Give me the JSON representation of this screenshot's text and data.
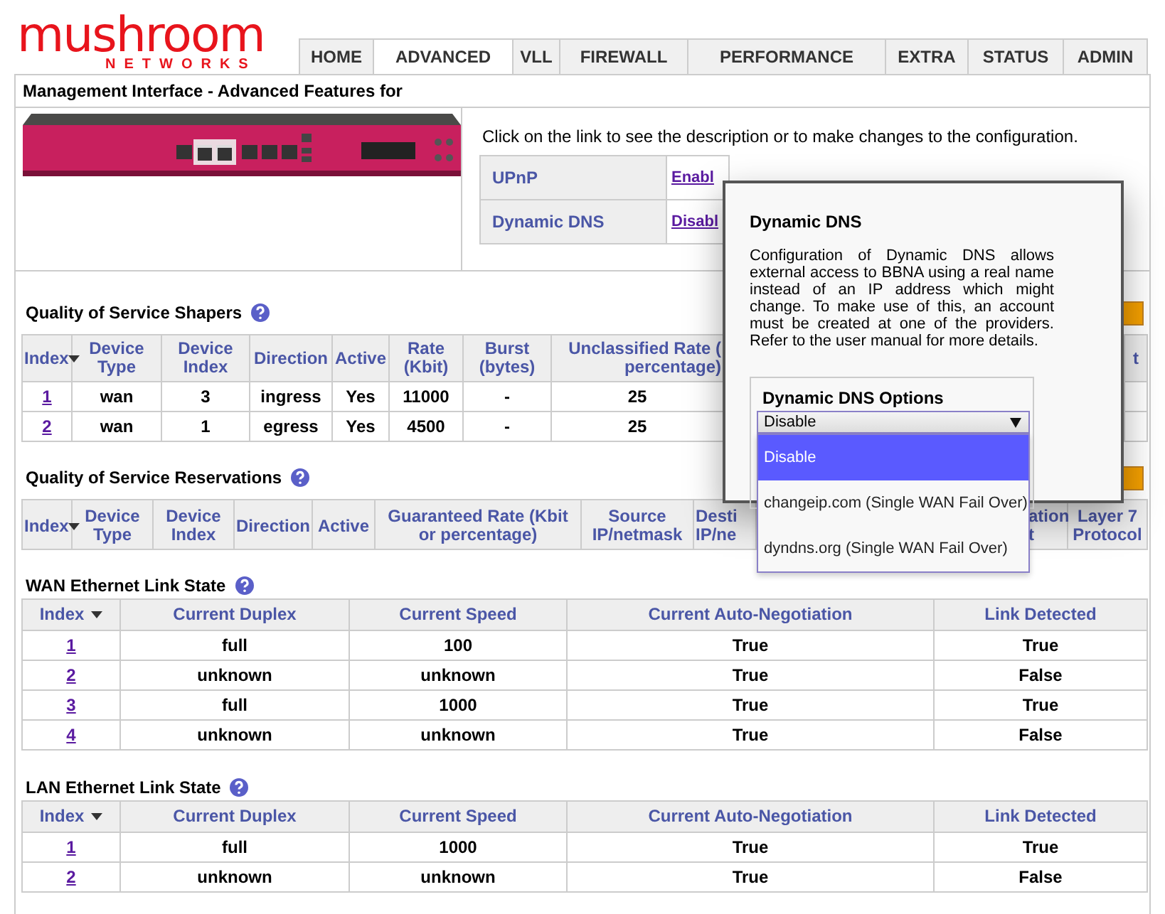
{
  "logo": {
    "name": "mushroom",
    "subtitle": "NETWORKS"
  },
  "nav_tabs": [
    {
      "label": "HOME",
      "selected": false
    },
    {
      "label": "ADVANCED",
      "selected": true
    },
    {
      "label": "VLL",
      "selected": false
    },
    {
      "label": "FIREWALL",
      "selected": false
    },
    {
      "label": "PERFORMANCE",
      "selected": false
    },
    {
      "label": "EXTRA",
      "selected": false
    },
    {
      "label": "STATUS",
      "selected": false
    },
    {
      "label": "ADMIN",
      "selected": false
    }
  ],
  "panel_title": "Management Interface - Advanced Features for",
  "intro": "Click on the link to see the description or to make changes to the configuration.",
  "features": [
    {
      "name": "UPnP",
      "link": "Enabl"
    },
    {
      "name": "Dynamic DNS",
      "link": "Disabl"
    }
  ],
  "qos_shapers": {
    "title": "Quality of Service Shapers",
    "columns": [
      "Index",
      "Device Type",
      "Device Index",
      "Direction",
      "Active",
      "Rate (Kbit)",
      "Burst (bytes)",
      "Unclassified Rate ( percentage)",
      "t"
    ],
    "rows": [
      [
        "1",
        "wan",
        "3",
        "ingress",
        "Yes",
        "11000",
        "-",
        "25"
      ],
      [
        "2",
        "wan",
        "1",
        "egress",
        "Yes",
        "4500",
        "-",
        "25"
      ]
    ]
  },
  "qos_reservations": {
    "title": "Quality of Service Reservations",
    "columns": [
      "Index",
      "Device Type",
      "Device Index",
      "Direction",
      "Active",
      "Guaranteed Rate (Kbit or percentage)",
      "Source IP/netmask",
      "Desti IP/ne",
      "ation t",
      "Layer 7 Protocol"
    ]
  },
  "wan_link_state": {
    "title": "WAN Ethernet Link State",
    "columns": [
      "Index",
      "Current Duplex",
      "Current Speed",
      "Current Auto-Negotiation",
      "Link Detected"
    ],
    "rows": [
      [
        "1",
        "full",
        "100",
        "True",
        "True"
      ],
      [
        "2",
        "unknown",
        "unknown",
        "True",
        "False"
      ],
      [
        "3",
        "full",
        "1000",
        "True",
        "True"
      ],
      [
        "4",
        "unknown",
        "unknown",
        "True",
        "False"
      ]
    ]
  },
  "lan_link_state": {
    "title": "LAN Ethernet Link State",
    "columns": [
      "Index",
      "Current Duplex",
      "Current Speed",
      "Current Auto-Negotiation",
      "Link Detected"
    ],
    "rows": [
      [
        "1",
        "full",
        "1000",
        "True",
        "True"
      ],
      [
        "2",
        "unknown",
        "unknown",
        "True",
        "False"
      ]
    ]
  },
  "dialog": {
    "title": "Dynamic DNS",
    "description": "Configuration of Dynamic DNS allows external access to BBNA using a real name instead of an IP address which might change. To make use of this, an account must be created at one of the providers. Refer to the user manual for more details.",
    "options_title": "Dynamic DNS Options",
    "select_value": "Disable",
    "options": [
      {
        "label": "Disable",
        "selected": true
      },
      {
        "label": "changeip.com (Single WAN Fail Over)",
        "selected": false
      },
      {
        "label": "dyndns.org (Single WAN Fail Over)",
        "selected": false
      }
    ]
  }
}
